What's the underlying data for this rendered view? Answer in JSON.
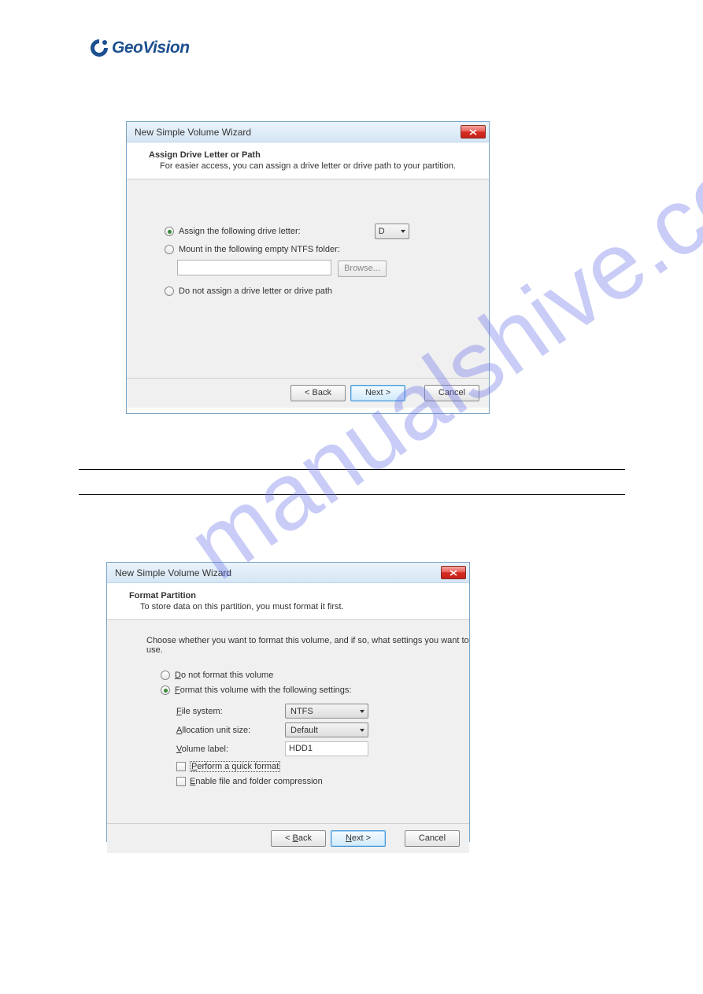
{
  "logo": {
    "text": "GeoVision"
  },
  "watermark": "manualshive.com",
  "dialog1": {
    "title": "New Simple Volume Wizard",
    "headerTitle": "Assign Drive Letter or Path",
    "headerSub": "For easier access, you can assign a drive letter or drive path to your partition.",
    "radio1": "Assign the following drive letter:",
    "driveLetter": "D",
    "radio2": "Mount in the following empty NTFS folder:",
    "browse": "Browse...",
    "radio3": "Do not assign a drive letter or drive path",
    "back": "< Back",
    "next": "Next >",
    "cancel": "Cancel"
  },
  "dialog2": {
    "title": "New Simple Volume Wizard",
    "headerTitle": "Format Partition",
    "headerSub": "To store data on this partition, you must format it first.",
    "prompt": "Choose whether you want to format this volume, and if so, what settings you want to use.",
    "radio1_pre": "D",
    "radio1_post": "o not format this volume",
    "radio2_pre": "F",
    "radio2_post": "ormat this volume with the following settings:",
    "fsLabel_pre": "F",
    "fsLabel_post": "ile system:",
    "fsValue": "NTFS",
    "ausLabel_pre": "A",
    "ausLabel_post": "llocation unit size:",
    "ausValue": "Default",
    "volLabel_pre": "V",
    "volLabel_post": "olume label:",
    "volValue": "HDD1",
    "quickFormat_pre": "P",
    "quickFormat_post": "erform a quick format",
    "compress_pre": "E",
    "compress_post": "nable file and folder compression",
    "back_pre": "< ",
    "back_u": "B",
    "back_post": "ack",
    "next_pre": "",
    "next_u": "N",
    "next_post": "ext >",
    "cancel": "Cancel"
  }
}
